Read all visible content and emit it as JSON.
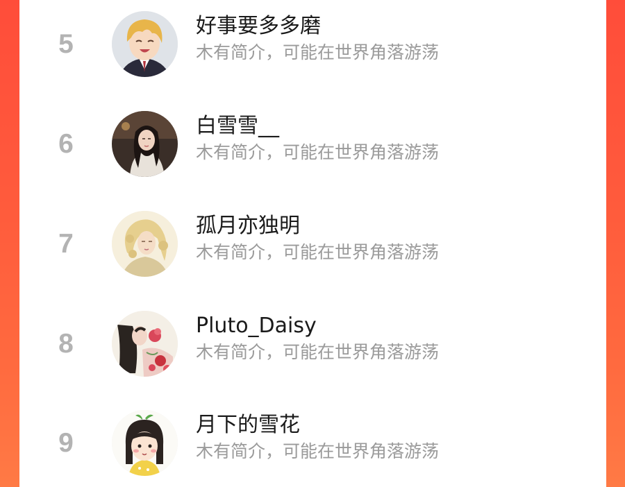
{
  "theme": {
    "accent": "#ff5a3c",
    "rank_color": "#b3b3b3",
    "name_color": "#1a1a1a",
    "bio_color": "#9a9a9a"
  },
  "ranking": {
    "items": [
      {
        "rank": "5",
        "name": "好事要多多磨",
        "bio": "木有简介，可能在世界角落游荡",
        "avatar": "anime-boy-avatar"
      },
      {
        "rank": "6",
        "name": "白雪雪__",
        "bio": "木有简介，可能在世界角落游荡",
        "avatar": "girl-photo-avatar"
      },
      {
        "rank": "7",
        "name": "孤月亦独明",
        "bio": "木有简介，可能在世界角落游荡",
        "avatar": "painted-lady-avatar"
      },
      {
        "rank": "8",
        "name": "Pluto_Daisy",
        "bio": "木有简介，可能在世界角落游荡",
        "avatar": "floral-illustration-avatar"
      },
      {
        "rank": "9",
        "name": "月下的雪花",
        "bio": "木有简介，可能在世界角落游荡",
        "avatar": "cartoon-girl-avatar"
      }
    ]
  }
}
